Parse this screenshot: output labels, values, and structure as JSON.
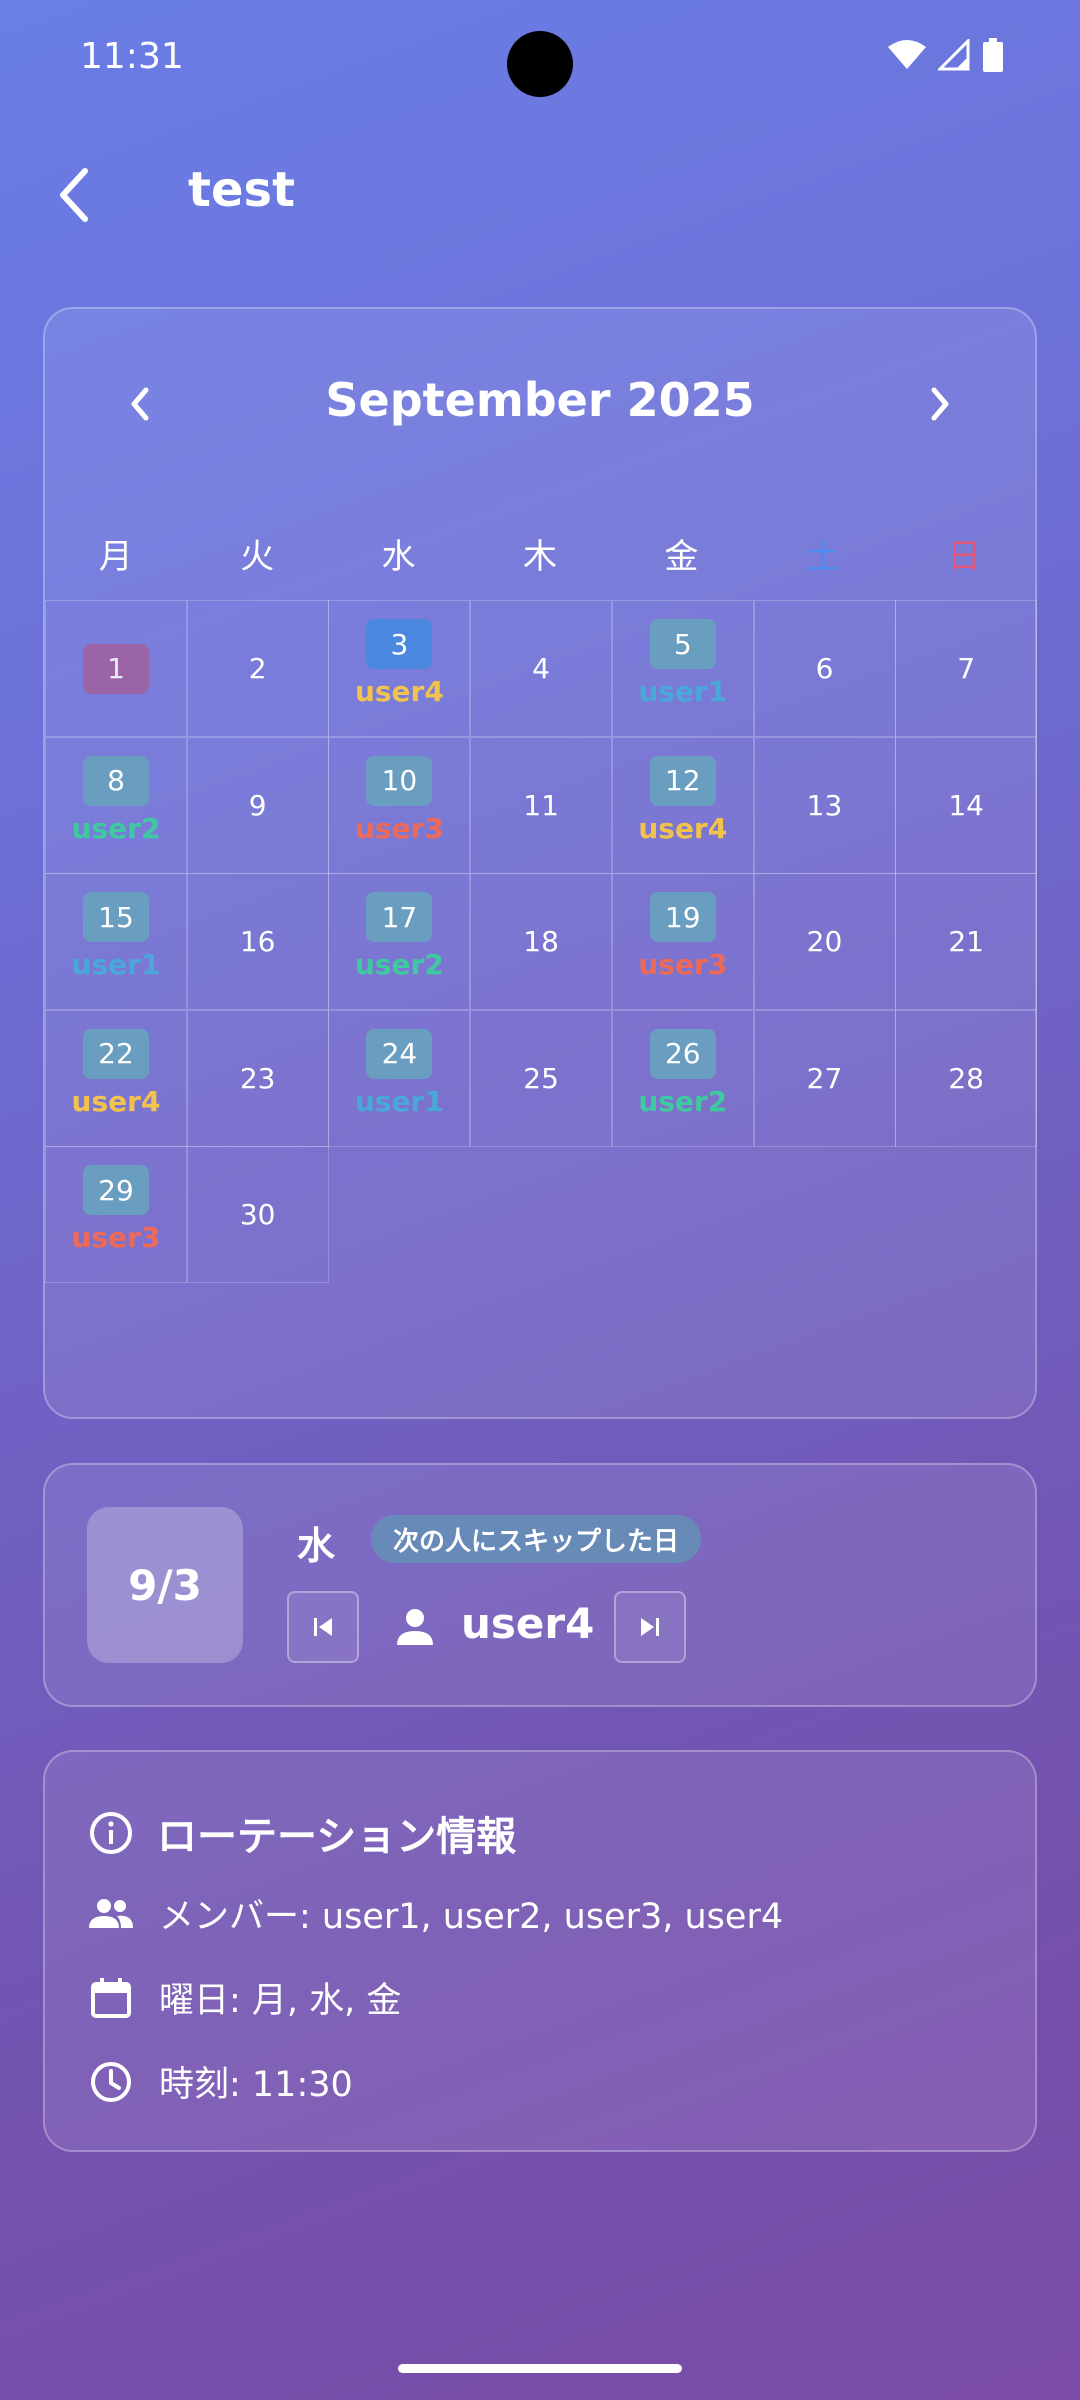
{
  "status_bar": {
    "time": "11:31"
  },
  "app_bar": {
    "title": "test"
  },
  "calendar": {
    "month_label": "September 2025",
    "weekdays": [
      {
        "label": "月",
        "color": "#ffffff"
      },
      {
        "label": "火",
        "color": "#ffffff"
      },
      {
        "label": "水",
        "color": "#ffffff"
      },
      {
        "label": "木",
        "color": "#ffffff"
      },
      {
        "label": "金",
        "color": "#ffffff"
      },
      {
        "label": "土",
        "color": "#4a8cf0"
      },
      {
        "label": "日",
        "color": "#e0557a"
      }
    ],
    "days": [
      {
        "day": "1",
        "user": "",
        "badge": "today"
      },
      {
        "day": "2",
        "user": ""
      },
      {
        "day": "3",
        "user": "user4",
        "badge": "selected"
      },
      {
        "day": "4",
        "user": ""
      },
      {
        "day": "5",
        "user": "user1",
        "badge": "duty"
      },
      {
        "day": "6",
        "user": ""
      },
      {
        "day": "7",
        "user": ""
      },
      {
        "day": "8",
        "user": "user2",
        "badge": "duty"
      },
      {
        "day": "9",
        "user": ""
      },
      {
        "day": "10",
        "user": "user3",
        "badge": "duty"
      },
      {
        "day": "11",
        "user": ""
      },
      {
        "day": "12",
        "user": "user4",
        "badge": "duty"
      },
      {
        "day": "13",
        "user": ""
      },
      {
        "day": "14",
        "user": ""
      },
      {
        "day": "15",
        "user": "user1",
        "badge": "duty"
      },
      {
        "day": "16",
        "user": ""
      },
      {
        "day": "17",
        "user": "user2",
        "badge": "duty"
      },
      {
        "day": "18",
        "user": ""
      },
      {
        "day": "19",
        "user": "user3",
        "badge": "duty"
      },
      {
        "day": "20",
        "user": ""
      },
      {
        "day": "21",
        "user": ""
      },
      {
        "day": "22",
        "user": "user4",
        "badge": "duty"
      },
      {
        "day": "23",
        "user": ""
      },
      {
        "day": "24",
        "user": "user1",
        "badge": "duty"
      },
      {
        "day": "25",
        "user": ""
      },
      {
        "day": "26",
        "user": "user2",
        "badge": "duty"
      },
      {
        "day": "27",
        "user": ""
      },
      {
        "day": "28",
        "user": ""
      },
      {
        "day": "29",
        "user": "user3",
        "badge": "duty"
      },
      {
        "day": "30",
        "user": ""
      }
    ],
    "user_colors": {
      "user1": "#4aa8d8",
      "user2": "#3fc9a0",
      "user3": "#ee6a58",
      "user4": "#f2c24e"
    },
    "badge_colors": {
      "today": "#a0609e",
      "selected": "#4a88e0",
      "duty": "#6a9ec0"
    }
  },
  "selected_day": {
    "date": "9/3",
    "weekday": "水",
    "note": "次の人にスキップした日",
    "user": "user4"
  },
  "rotation_info": {
    "title": "ローテーション情報",
    "members": "メンバー: user1, user2, user3, user4",
    "days": "曜日: 月, 水, 金",
    "time": "時刻: 11:30"
  }
}
